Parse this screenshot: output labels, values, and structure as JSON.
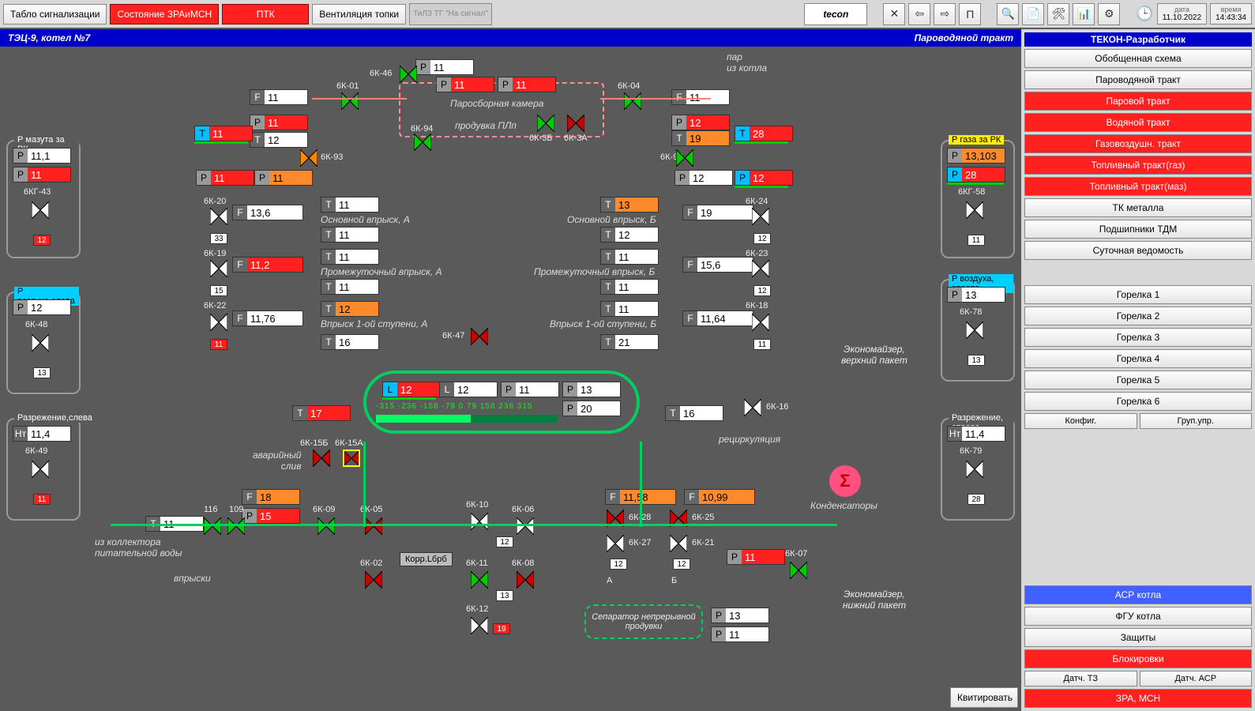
{
  "topbar": {
    "tablo": "Табло сигнализации",
    "sost": "Состояние ЗРАиМСН",
    "ptk": "ПТК",
    "vent": "Вентиляция топки",
    "tilz": "ТиЛЗ ТГ\n\"На сигнал\"",
    "logo": "tecon",
    "date_label": "дата",
    "date": "11.10.2022",
    "time_label": "время",
    "time": "14:43:34"
  },
  "title": {
    "left": "ТЭЦ-9, котел №7",
    "right": "Пароводяной тракт"
  },
  "sidebar": {
    "header": "ТЕКОН-Разработчик",
    "items": [
      {
        "label": "Обобщенная схема",
        "red": false
      },
      {
        "label": "Пароводяной тракт",
        "red": false
      },
      {
        "label": "Паровой тракт",
        "red": true
      },
      {
        "label": "Водяной тракт",
        "red": true
      },
      {
        "label": "Газовоздушн. тракт",
        "red": true
      },
      {
        "label": "Топливный тракт(газ)",
        "red": true
      },
      {
        "label": "Топливный тракт(маз)",
        "red": true
      },
      {
        "label": "ТК металла",
        "red": false
      },
      {
        "label": "Подшипники ТДМ",
        "red": false
      },
      {
        "label": "Суточная ведомость",
        "red": false
      }
    ],
    "burners": [
      "Горелка 1",
      "Горелка 2",
      "Горелка 3",
      "Горелка 4",
      "Горелка 5",
      "Горелка 6"
    ],
    "config": "Конфиг.",
    "group": "Груп.упр.",
    "bottom": [
      {
        "label": "АСР котла",
        "cls": "blue"
      },
      {
        "label": "ФГУ котла",
        "cls": ""
      },
      {
        "label": "Защиты",
        "cls": ""
      },
      {
        "label": "Блокировки",
        "cls": "red"
      }
    ],
    "row_last": {
      "a": "Датч. ТЗ",
      "b": "Датч. АСР"
    },
    "zra": "ЗРА, МСН"
  },
  "ack": "Квитировать",
  "korr": "Корр.Lбрб",
  "panels": {
    "mazut": {
      "title": "Р мазута за РК",
      "p1": "11,1",
      "p2": "11",
      "valve": "6КГ-43",
      "badge": "12"
    },
    "gaz": {
      "title": "Р газа за РК",
      "p1": "13,103",
      "p2": "28",
      "valve": "6КГ-58",
      "badge": "11"
    },
    "air_l": {
      "title": "Р воздуха,слева",
      "p": "12",
      "valve": "6К-48",
      "badge": "13"
    },
    "air_r": {
      "title": "Р воздуха, справа",
      "p": "13",
      "valve": "6К-78",
      "badge": "13"
    },
    "vac_l": {
      "title": "Разрежение,слева",
      "h": "11,4",
      "valve": "6К-49",
      "badge": "11"
    },
    "vac_r": {
      "title": "Разрежение, справа",
      "h": "11,4",
      "valve": "6К-79",
      "badge": "28"
    }
  },
  "center": {
    "steam_chamber": "Паросборная камера",
    "purge": "продувка ПЛп",
    "par_note": "пар\nиз котла",
    "inj_a": "Основной впрыск, А",
    "inj_b": "Основной впрыск, Б",
    "inj_pa": "Промежуточный впрыск, А",
    "inj_pb": "Промежуточный впрыск, Б",
    "inj_1a": "Впрыск 1-ой ступени, А",
    "inj_1b": "Впрыск 1-ой ступени, Б",
    "avar": "аварийный\nслив",
    "recirc": "рециркуляция",
    "kond": "Конденсаторы",
    "econ_top": "Экономайзер,\nверхний пакет",
    "econ_bot": "Экономайзер,\nнижний пакет",
    "feed": "из коллектора\nпитательной воды",
    "vpr": "впрыски",
    "sep": "Сепаратор\nнепрерывной продувки",
    "scale": "-315 -236 -158  -79    0     79   158  236  315",
    "ab_a": "А",
    "ab_b": "Б"
  },
  "readings": {
    "topP": "11",
    "topP2": "11",
    "topP3": "11",
    "leftF": "11",
    "leftP": "11",
    "leftT": "12",
    "leftTblue": "11",
    "rightF": "11",
    "rightP": "12",
    "rightT": "19",
    "rightTblue": "28",
    "l93P1": "11",
    "l93P2": "11",
    "r95P1": "12",
    "r95P2": "12",
    "f20": "13,6",
    "b20": "33",
    "f19": "11,2",
    "b19": "15",
    "f22": "11,76",
    "b22": "11",
    "f24": "19",
    "b24": "12",
    "f23": "15,6",
    "b23": "12",
    "f18": "11,64",
    "b18": "11",
    "ta1": "11",
    "ta2": "11",
    "tb1": "13",
    "tb2": "12",
    "ta3": "11",
    "ta4": "11",
    "tb3": "11",
    "tb4": "11",
    "ta5": "12",
    "ta6": "16",
    "tb5": "11",
    "tb6": "21",
    "drumLred": "12",
    "drumL": "12",
    "drumP": "11",
    "drumP2": "13",
    "drumP3": "20",
    "drumTleft": "17",
    "drumTright": "16",
    "f18b": "18",
    "p15": "15",
    "t11": "11",
    "f1158": "11,58",
    "f1099": "10,99",
    "p11b": "11",
    "p13s": "13",
    "p11s": "11",
    "b116": "116",
    "b109": "109",
    "b06": "12",
    "b11": "13",
    "b12": "19",
    "b27": "12",
    "b21": "12"
  },
  "valves": {
    "k46": "6К-46",
    "k01": "6К-01",
    "k04": "6К-04",
    "k3b": "6К-3Б",
    "k3a": "6К-3А",
    "k93": "6К-93",
    "k94": "6К-94",
    "k95": "6К-95",
    "k20": "6К-20",
    "k19": "6К-19",
    "k22": "6К-22",
    "k24": "6К-24",
    "k23": "6К-23",
    "k18": "6К-18",
    "k47": "6К-47",
    "k15b": "6К-15Б",
    "k15a": "6К-15А",
    "k16": "6К-16",
    "k09": "6К-09",
    "k05": "6К-05",
    "k10": "6К-10",
    "k06": "6К-06",
    "k02": "6К-02",
    "k11": "6К-11",
    "k08": "6К-08",
    "k12": "6К-12",
    "k28": "6К-28",
    "k27": "6К-27",
    "k25": "6К-25",
    "k21": "6К-21",
    "k07": "6К-07"
  }
}
